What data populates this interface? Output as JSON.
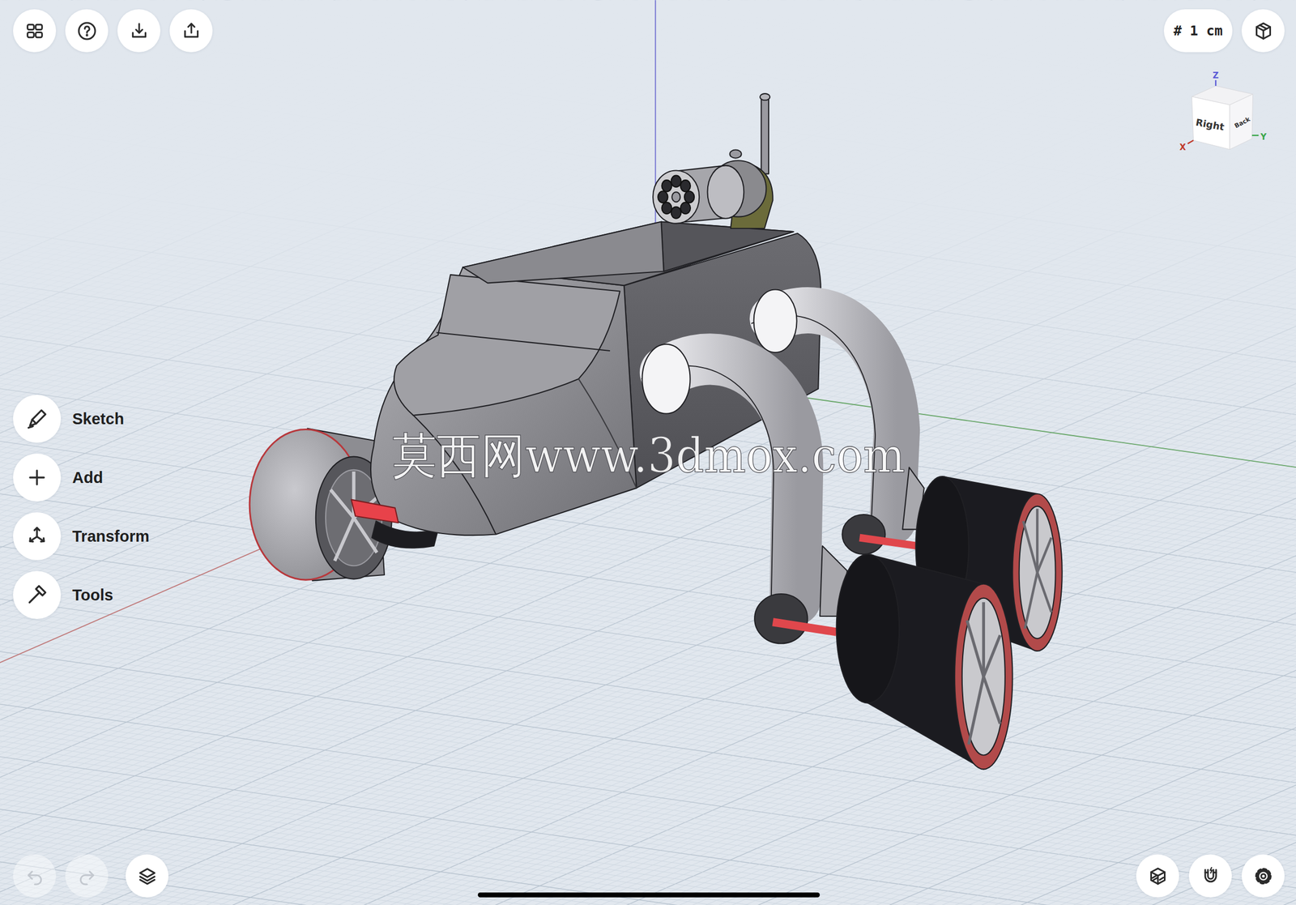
{
  "toolbar": {
    "grid_size": "# 1 cm"
  },
  "tools": [
    {
      "label": "Sketch"
    },
    {
      "label": "Add"
    },
    {
      "label": "Transform"
    },
    {
      "label": "Tools"
    }
  ],
  "view_cube": {
    "faces": [
      "Right",
      "Back"
    ],
    "axes": [
      {
        "label": "Z",
        "color": "#5b5bd6"
      },
      {
        "label": "X",
        "color": "#c0392b"
      },
      {
        "label": "Y",
        "color": "#3aa64a"
      }
    ]
  },
  "history": {
    "undo_disabled": true,
    "redo_disabled": true
  },
  "watermark": "莫西网www.3dmox.com"
}
